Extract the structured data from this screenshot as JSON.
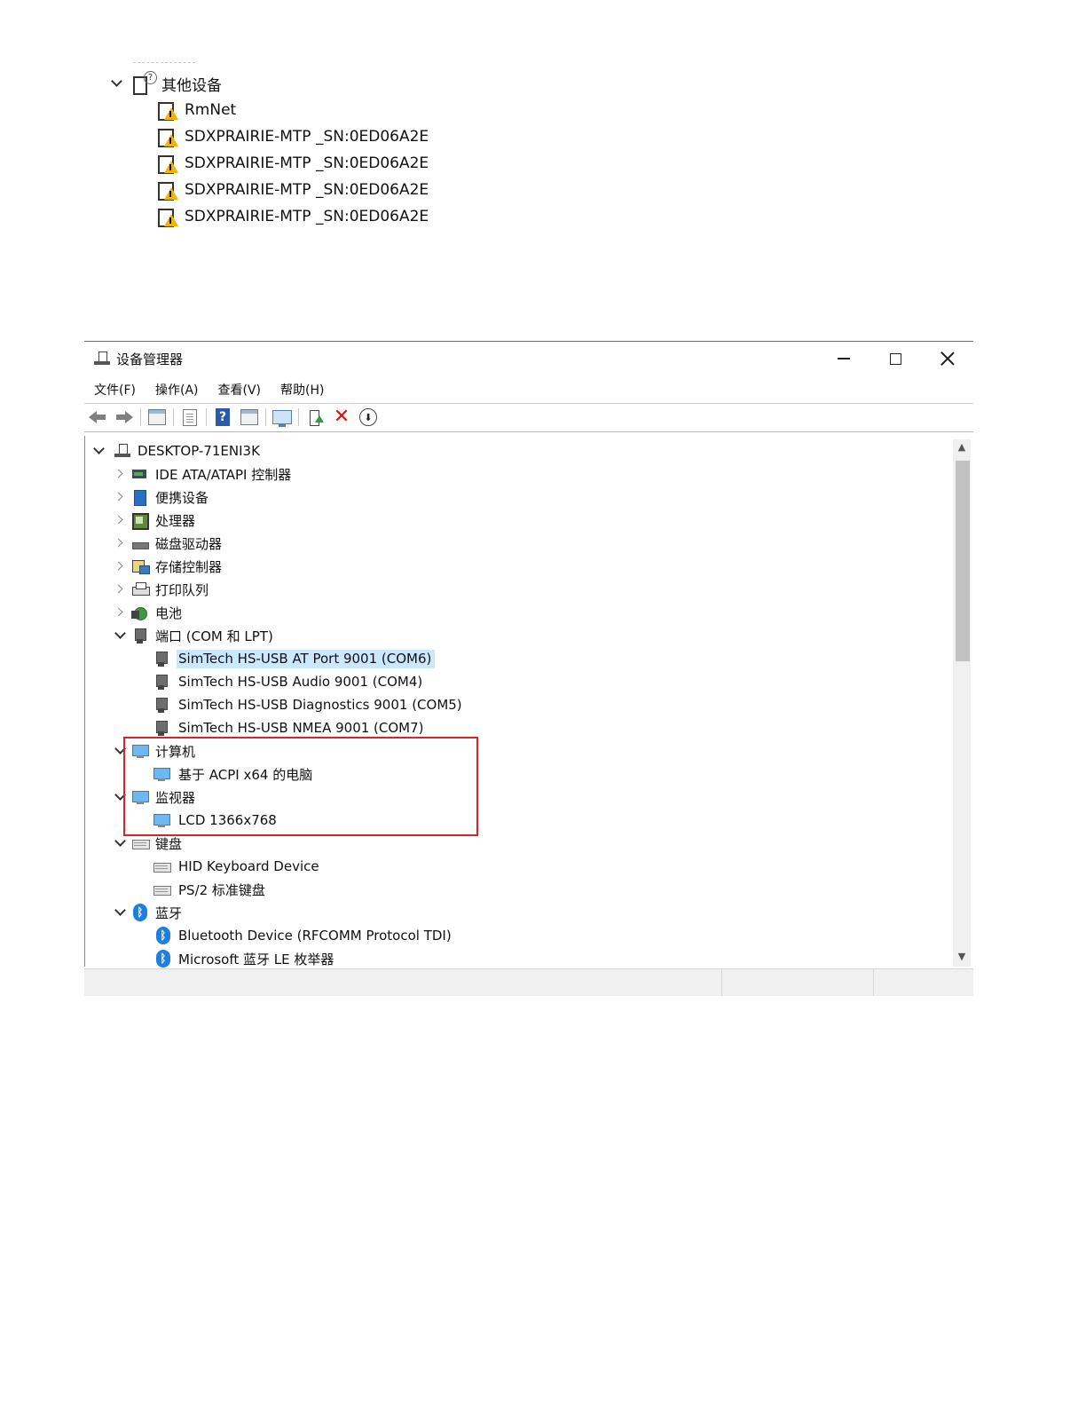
{
  "other_devices": {
    "label": "其他设备",
    "children": [
      "RmNet",
      "SDXPRAIRIE-MTP _SN:0ED06A2E",
      "SDXPRAIRIE-MTP _SN:0ED06A2E",
      "SDXPRAIRIE-MTP _SN:0ED06A2E",
      "SDXPRAIRIE-MTP _SN:0ED06A2E"
    ]
  },
  "window": {
    "title": "设备管理器",
    "menu": [
      "文件(F)",
      "操作(A)",
      "查看(V)",
      "帮助(H)"
    ],
    "toolbar_icons": [
      "back-arrow-icon",
      "forward-arrow-icon",
      "show-hide-tree-icon",
      "properties-icon",
      "help-icon",
      "action-pane-icon",
      "scan-hardware-icon",
      "update-driver-icon",
      "uninstall-icon",
      "disable-device-icon"
    ],
    "tree": {
      "root": "DESKTOP-71ENI3K",
      "categories": [
        {
          "label": "IDE ATA/ATAPI 控制器",
          "expanded": false,
          "icon": "ide-controller-icon"
        },
        {
          "label": "便携设备",
          "expanded": false,
          "icon": "portable-device-icon"
        },
        {
          "label": "处理器",
          "expanded": false,
          "icon": "processor-icon"
        },
        {
          "label": "磁盘驱动器",
          "expanded": false,
          "icon": "disk-drive-icon"
        },
        {
          "label": "存储控制器",
          "expanded": false,
          "icon": "storage-controller-icon"
        },
        {
          "label": "打印队列",
          "expanded": false,
          "icon": "printer-icon"
        },
        {
          "label": "电池",
          "expanded": false,
          "icon": "battery-icon"
        },
        {
          "label": "端口 (COM 和 LPT)",
          "expanded": true,
          "icon": "port-icon",
          "children": [
            "SimTech HS-USB AT Port 9001 (COM6)",
            "SimTech HS-USB Audio 9001 (COM4)",
            "SimTech HS-USB Diagnostics 9001 (COM5)",
            "SimTech HS-USB NMEA 9001 (COM7)"
          ]
        },
        {
          "label": "计算机",
          "expanded": true,
          "icon": "computer-icon",
          "children": [
            "基于 ACPI x64 的电脑"
          ]
        },
        {
          "label": "监视器",
          "expanded": true,
          "icon": "monitor-icon",
          "children": [
            "LCD 1366x768"
          ]
        },
        {
          "label": "键盘",
          "expanded": true,
          "icon": "keyboard-icon",
          "children": [
            "HID Keyboard Device",
            "PS/2 标准键盘"
          ]
        },
        {
          "label": "蓝牙",
          "expanded": true,
          "icon": "bluetooth-icon",
          "children": [
            "Bluetooth Device (RFCOMM Protocol TDI)",
            "Microsoft 蓝牙 LE 枚举器"
          ]
        }
      ]
    },
    "selected_item": "SimTech HS-USB AT Port 9001 (COM6)",
    "highlight_color": "#d9232a",
    "selection_color": "#cce8ff"
  }
}
